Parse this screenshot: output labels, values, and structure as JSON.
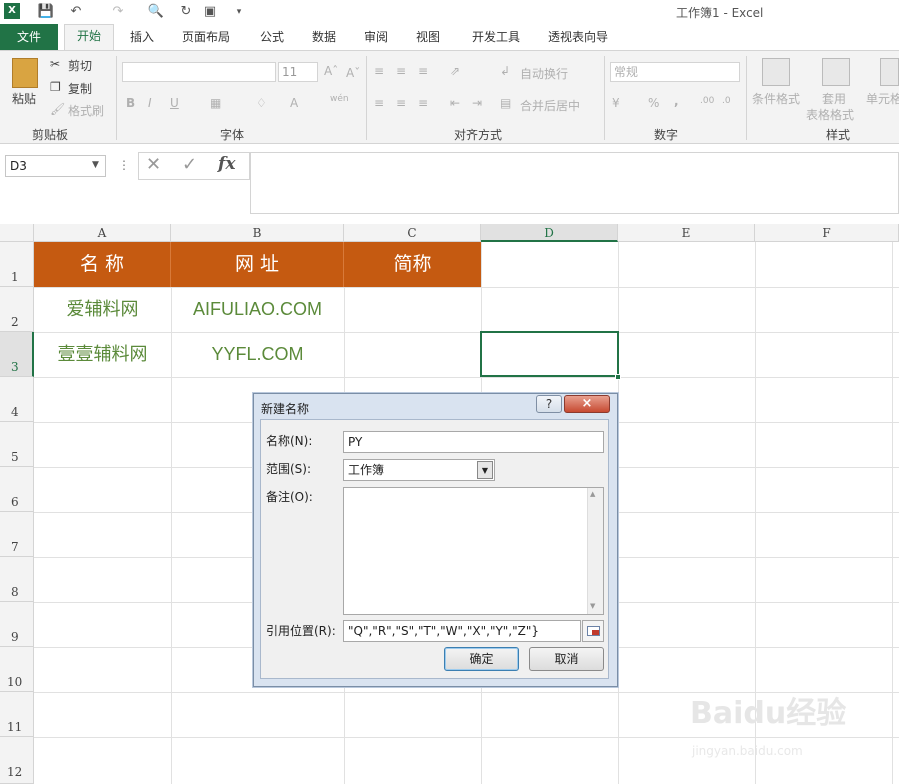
{
  "title": "工作簿1 - Excel",
  "tabs": [
    "文件",
    "开始",
    "插入",
    "页面布局",
    "公式",
    "数据",
    "审阅",
    "视图",
    "开发工具",
    "透视表向导"
  ],
  "clipboard": {
    "paste": "粘贴",
    "cut": "剪切",
    "copy": "复制",
    "format_painter": "格式刷",
    "group": "剪贴板"
  },
  "font": {
    "size": "11",
    "bold": "B",
    "italic": "I",
    "underline": "U",
    "group": "字体"
  },
  "alignment": {
    "wrap": "自动换行",
    "merge": "合并后居中",
    "group": "对齐方式"
  },
  "number": {
    "format": "常规",
    "percent": "%",
    "comma": ",",
    "group": "数字"
  },
  "styles": {
    "conditional": "条件格式",
    "table_line1": "套用",
    "table_line2": "表格格式",
    "cell": "单元格",
    "group": "样式"
  },
  "namebox": "D3",
  "fx": "fx",
  "columns": [
    "A",
    "B",
    "C",
    "D",
    "E",
    "F"
  ],
  "rows": [
    "1",
    "2",
    "3",
    "4",
    "5",
    "6",
    "7",
    "8",
    "9",
    "10",
    "11",
    "12"
  ],
  "sheet": {
    "A1": "名 称",
    "B1": "网 址",
    "C1": "简称",
    "A2": "爱辅料网",
    "B2": "AIFULIAO.COM",
    "A3": "壹壹辅料网",
    "B3": "YYFL.COM"
  },
  "dialog": {
    "title": "新建名称",
    "help": "?",
    "close": "×",
    "name_label": "名称(N):",
    "name_value": "PY",
    "scope_label": "范围(S):",
    "scope_value": "工作簿",
    "comment_label": "备注(O):",
    "ref_label": "引用位置(R):",
    "ref_value": "\"Q\",\"R\",\"S\",\"T\",\"W\",\"X\",\"Y\",\"Z\"}",
    "ok": "确定",
    "cancel": "取消"
  },
  "watermark": {
    "logo": "Baidu经验",
    "url": "jingyan.baidu.com"
  }
}
